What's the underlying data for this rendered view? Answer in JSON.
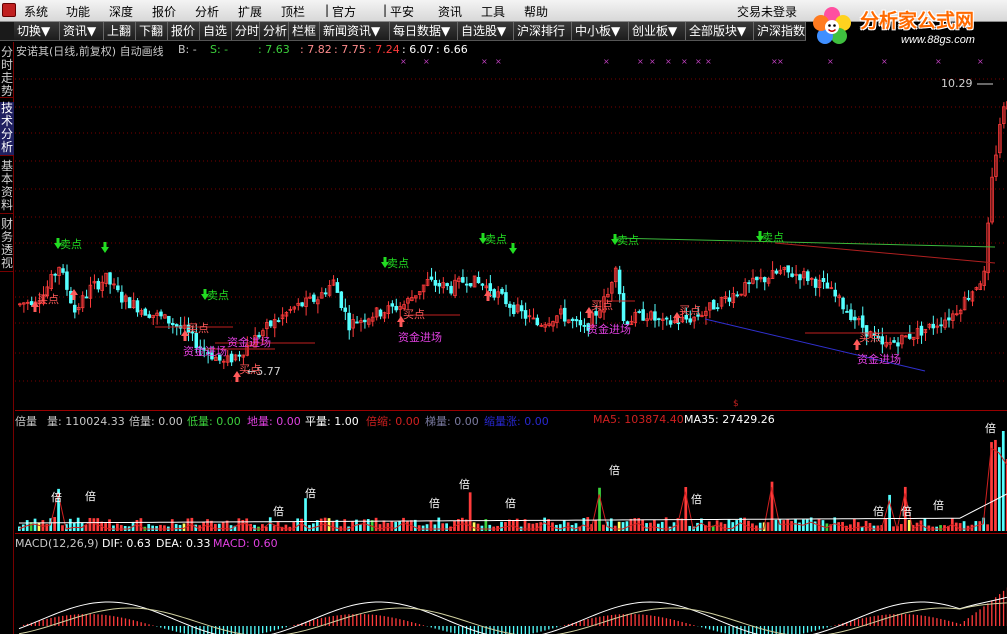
{
  "menu": {
    "items": [
      "系统",
      "功能",
      "深度",
      "报价",
      "分析",
      "扩展",
      "顶栏",
      "官方",
      "平安",
      "资讯",
      "工具",
      "帮助"
    ],
    "login_status": "交易未登录"
  },
  "brand": {
    "name": "分析家公式网",
    "url": "www.88gs.com"
  },
  "toolbar": {
    "buttons": [
      "切换▼",
      "资讯▼",
      "上翻",
      "下翻",
      "报价",
      "自选",
      "分时",
      "分析",
      "栏框",
      "新闻资讯▼",
      "每日数据▼",
      "自选股▼",
      "沪深排行",
      "中小板▼",
      "创业板▼",
      "全部版块▼",
      "沪深指数"
    ]
  },
  "left_tabs": [
    "分时走势",
    "技术分析",
    "基本资料",
    "财务透视"
  ],
  "info": {
    "stock": "安诺其(日线,前复权) 自动画线",
    "b_label": "B: -",
    "s_label": "S: -",
    "v1": ": 7.63",
    "v2": ": 7.82",
    "v3": ": 7.75",
    "v4": ": 7.24",
    "v5": ": 6.07",
    "v6": ": 6.66"
  },
  "main_chart": {
    "high_label": "10.29",
    "low_label": "5.77",
    "annotations": {
      "sell": "卖点",
      "buy": "买点",
      "fund": "资金进场"
    },
    "colors": {
      "up": "#ff3b3b",
      "down": "#54ffff",
      "sell_arrow": "#22dd22",
      "buy_arrow": "#ff5a5a",
      "fund_text": "#e040e0",
      "green_line": "#3cb83c",
      "red_line": "#b02020",
      "blue_line": "#3030d0"
    }
  },
  "volume": {
    "title": "倍量",
    "fields": [
      {
        "label": "量:",
        "value": "110024.33",
        "color": "#c8c8c8"
      },
      {
        "label": "倍量:",
        "value": "0.00",
        "color": "#c8c8c8"
      },
      {
        "label": "低量:",
        "value": "0.00",
        "color": "#3cd23c"
      },
      {
        "label": "地量:",
        "value": "0.00",
        "color": "#e040e0"
      },
      {
        "label": "平量:",
        "value": "1.00",
        "color": "#ffffff"
      },
      {
        "label": "倍缩:",
        "value": "0.00",
        "color": "#d02020"
      },
      {
        "label": "梯量:",
        "value": "0.00",
        "color": "#7a7aa0"
      },
      {
        "label": "缩量涨:",
        "value": "0.00",
        "color": "#2828d0"
      },
      {
        "label": "MA5:",
        "value": "103874.40",
        "color": "#d02020"
      },
      {
        "label": "MA35:",
        "value": "27429.26",
        "color": "#ffffff"
      }
    ],
    "marker": "倍"
  },
  "macd": {
    "title": "MACD(12,26,9)",
    "dif": "DIF: 0.63",
    "dea": "DEA: 0.33",
    "macd": "MACD: 0.60"
  }
}
